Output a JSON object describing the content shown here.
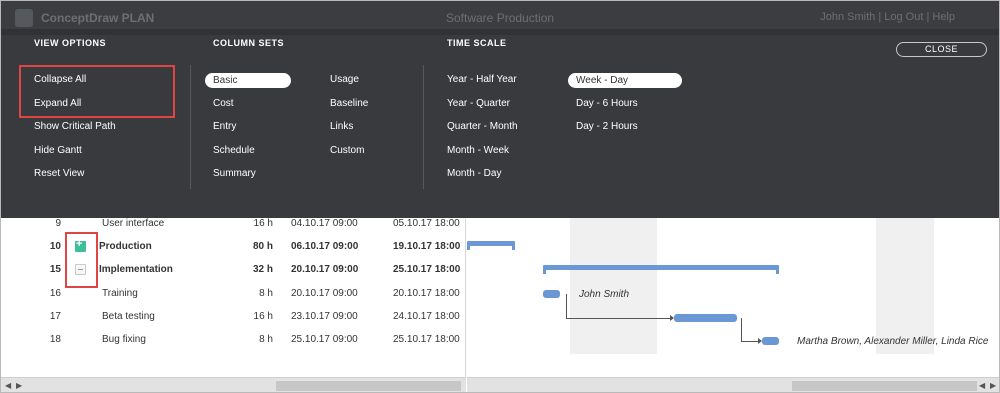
{
  "app": {
    "title": "ConceptDraw PLAN",
    "project": "Software Production",
    "user": "John Smith | Log Out | Help"
  },
  "panel": {
    "view_options": {
      "title": "VIEW OPTIONS",
      "items": [
        "Collapse All",
        "Expand All",
        "Show Critical Path",
        "Hide Gantt",
        "Reset View"
      ]
    },
    "column_sets": {
      "title": "COLUMN SETS",
      "col1": [
        "Basic",
        "Cost",
        "Entry",
        "Schedule",
        "Summary"
      ],
      "col2": [
        "Usage",
        "Baseline",
        "Links",
        "Custom"
      ],
      "selected": "Basic"
    },
    "time_scale": {
      "title": "TIME SCALE",
      "col1": [
        "Year - Half Year",
        "Year - Quarter",
        "Quarter - Month",
        "Month - Week",
        "Month - Day"
      ],
      "col2": [
        "Week - Day",
        "Day - 6 Hours",
        "Day - 2 Hours"
      ],
      "selected": "Week - Day"
    },
    "close_label": "CLOSE"
  },
  "rows": [
    {
      "id": "9",
      "name": "User interface",
      "duration": "16 h",
      "start": "04.10.17 09:00",
      "end": "05.10.17 18:00",
      "bold": false,
      "toggle": ""
    },
    {
      "id": "10",
      "name": "Production",
      "duration": "80 h",
      "start": "06.10.17 09:00",
      "end": "19.10.17 18:00",
      "bold": true,
      "toggle": "plus"
    },
    {
      "id": "15",
      "name": "Implementation",
      "duration": "32 h",
      "start": "20.10.17 09:00",
      "end": "25.10.17 18:00",
      "bold": true,
      "toggle": "minus"
    },
    {
      "id": "16",
      "name": "Training",
      "duration": "8 h",
      "start": "20.10.17 09:00",
      "end": "20.10.17 18:00",
      "bold": false,
      "toggle": ""
    },
    {
      "id": "17",
      "name": "Beta testing",
      "duration": "16 h",
      "start": "23.10.17 09:00",
      "end": "24.10.17 18:00",
      "bold": false,
      "toggle": ""
    },
    {
      "id": "18",
      "name": "Bug fixing",
      "duration": "8 h",
      "start": "25.10.17 09:00",
      "end": "25.10.17 18:00",
      "bold": false,
      "toggle": ""
    }
  ],
  "gantt": {
    "resource_training": "John Smith",
    "resource_bugfix": "Martha Brown, Alexander Miller, Linda Rice"
  },
  "colors": {
    "accent": "#3dbf9b",
    "bar": "#6b98d4",
    "highlight": "#e04545",
    "panel_bg": "#303235"
  }
}
